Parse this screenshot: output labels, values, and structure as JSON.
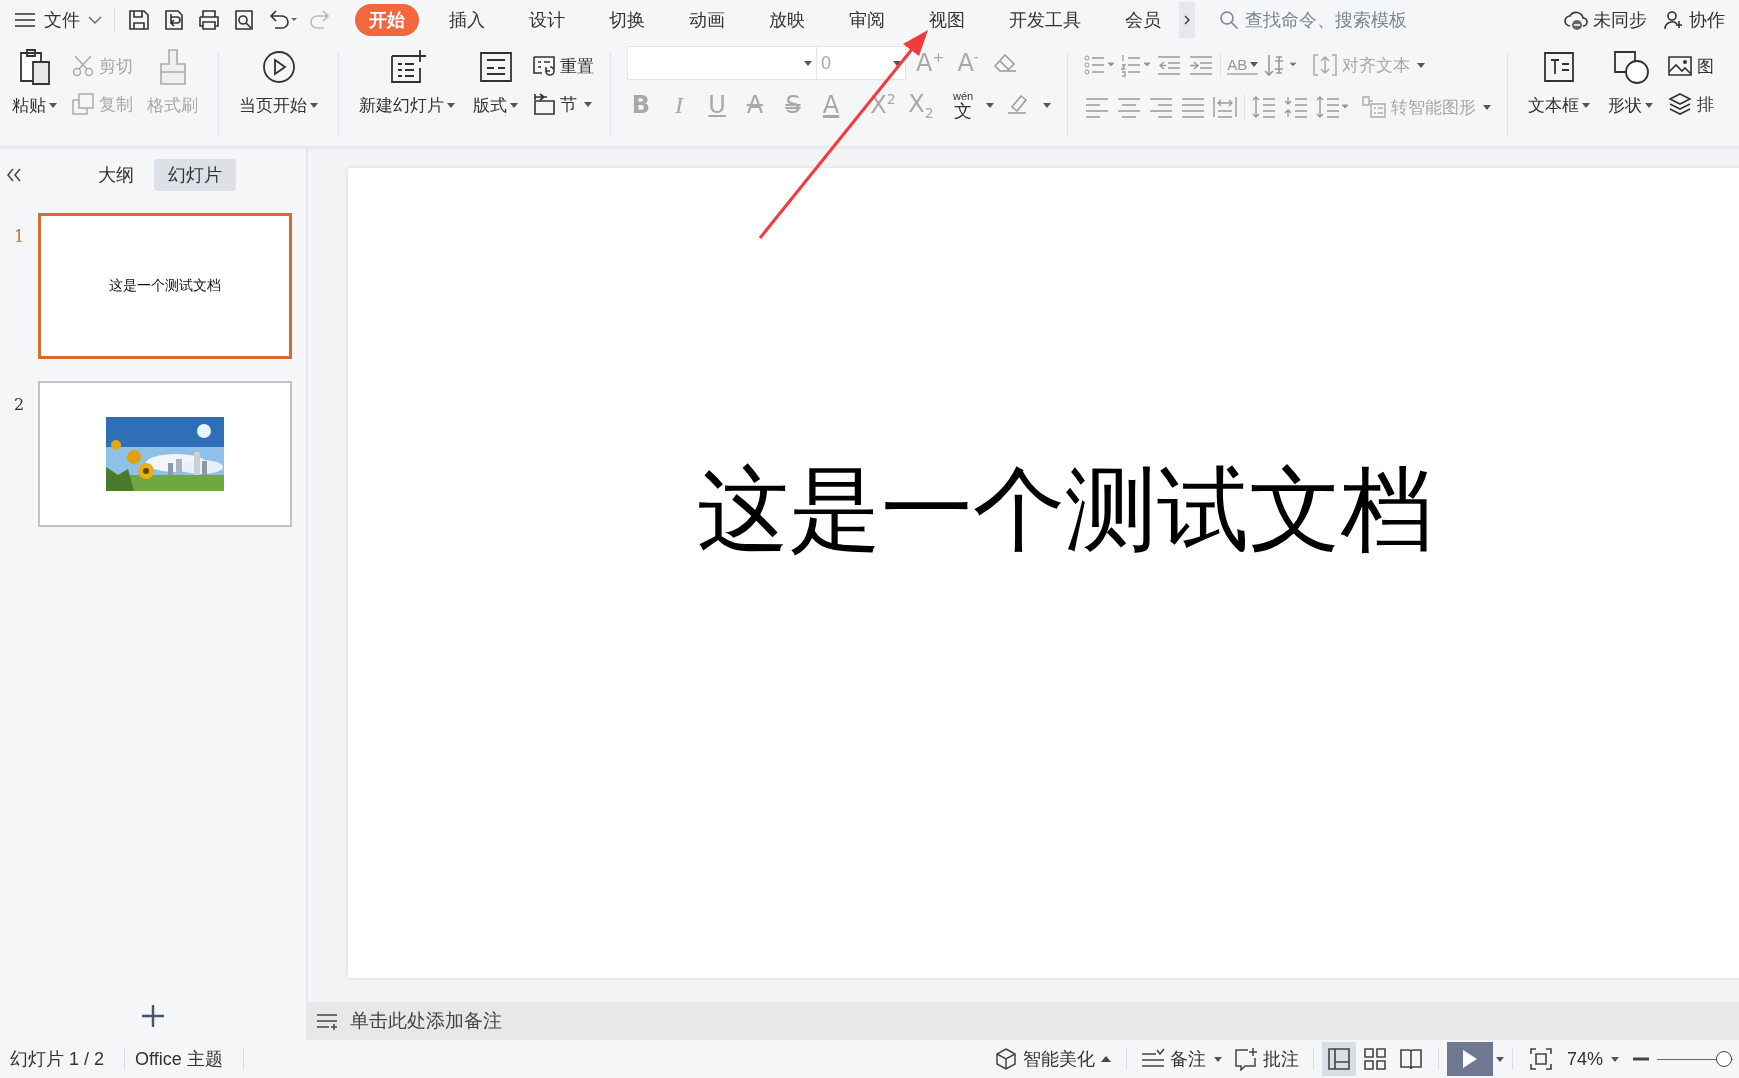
{
  "titlebar": {
    "menu": "文件",
    "tabs": [
      {
        "label": "开始",
        "selected": true
      },
      {
        "label": "插入",
        "selected": false
      },
      {
        "label": "设计",
        "selected": false
      },
      {
        "label": "切换",
        "selected": false
      },
      {
        "label": "动画",
        "selected": false
      },
      {
        "label": "放映",
        "selected": false
      },
      {
        "label": "审阅",
        "selected": false
      },
      {
        "label": "视图",
        "selected": false
      },
      {
        "label": "开发工具",
        "selected": false
      },
      {
        "label": "会员",
        "selected": false
      }
    ],
    "search": {
      "placeholder": "查找命令、搜索模板"
    },
    "sync": "未同步",
    "collab": "协作"
  },
  "ribbon": {
    "paste": {
      "label": "粘贴",
      "disabled": false
    },
    "cut": {
      "label": "剪切",
      "disabled": true
    },
    "copy": {
      "label": "复制",
      "disabled": true
    },
    "format_painter": {
      "label": "格式刷",
      "disabled": true
    },
    "start_from_current": {
      "label": "当页开始"
    },
    "new_slide": {
      "label": "新建幻灯片"
    },
    "layout": {
      "label": "版式"
    },
    "reset": {
      "label": "重置"
    },
    "section": {
      "label": "节"
    },
    "font": {
      "disabled": true,
      "size": "0",
      "grow": "A$^{+}$",
      "shrink": "A$^{-}$",
      "glyphs": [
        "B",
        "I",
        "U",
        "A",
        "S",
        "A",
        "X$^{2}$",
        "X$_{2}$"
      ],
      "phonetic": {
        "top": "wén",
        "bottom": "文"
      }
    },
    "paragraph": {
      "disabled": true,
      "spacing_label": "AB"
    },
    "align_text": {
      "label": "对齐文本",
      "disabled": true
    },
    "smartart": {
      "label": "转智能图形",
      "disabled": true
    },
    "text_box": {
      "label": "文本框"
    },
    "shape": {
      "label": "形状"
    },
    "picture": {
      "label": "图"
    },
    "arrange": {
      "label": "排"
    }
  },
  "sidebar": {
    "tabs": [
      {
        "label": "大纲",
        "selected": false
      },
      {
        "label": "幻灯片",
        "selected": true
      }
    ],
    "slides": [
      {
        "number": "1",
        "kind": "text",
        "text": "这是一个测试文档",
        "selected": true
      },
      {
        "number": "2",
        "kind": "picture",
        "selected": false
      }
    ]
  },
  "canvas": {
    "title": "这是一个测试文档"
  },
  "notes": {
    "placeholder": "单击此处添加备注"
  },
  "status": {
    "slide_count": "幻灯片 1 / 2",
    "theme": "Office 主题",
    "beautify": "智能美化",
    "notes": "备注",
    "comments": "批注",
    "views": [
      {
        "selected": true
      },
      {
        "selected": false
      },
      {
        "selected": false
      }
    ],
    "zoom": "74%",
    "zoom_slider": {
      "level": 0.9
    }
  }
}
